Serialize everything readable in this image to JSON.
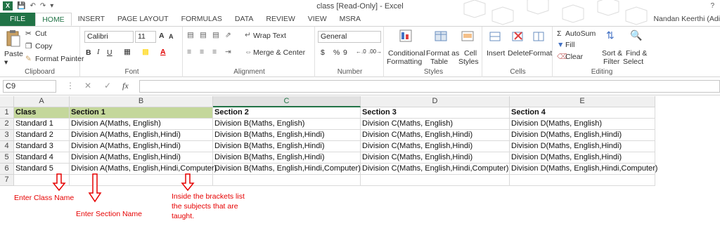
{
  "window": {
    "title": "class  [Read-Only] - Excel",
    "help": "?",
    "user": "Nandan Keerthi (Adi"
  },
  "tabs": [
    "FILE",
    "HOME",
    "INSERT",
    "PAGE LAYOUT",
    "FORMULAS",
    "DATA",
    "REVIEW",
    "VIEW",
    "MSRA"
  ],
  "active_tab": "HOME",
  "ribbon": {
    "clipboard": {
      "paste": "Paste",
      "cut": "Cut",
      "copy": "Copy",
      "format_painter": "Format Painter",
      "label": "Clipboard"
    },
    "font": {
      "name": "Calibri",
      "size": "11",
      "label": "Font",
      "bold": "B",
      "italic": "I",
      "underline": "U",
      "grow": "A",
      "shrink": "A"
    },
    "alignment": {
      "wrap": "Wrap Text",
      "merge": "Merge & Center",
      "label": "Alignment"
    },
    "number": {
      "format": "General",
      "currency": "$",
      "percent": "%",
      "comma": "9",
      "label": "Number"
    },
    "styles": {
      "conditional": "Conditional",
      "conditional2": "Formatting",
      "format_table": "Format as",
      "format_table2": "Table",
      "cell_styles": "Cell",
      "cell_styles2": "Styles",
      "label": "Styles"
    },
    "cells": {
      "insert": "Insert",
      "delete": "Delete",
      "format": "Format",
      "label": "Cells"
    },
    "editing": {
      "autosum": "AutoSum",
      "fill": "Fill",
      "clear": "Clear",
      "sort": "Sort &",
      "sort2": "Filter",
      "find": "Find &",
      "find2": "Select",
      "label": "Editing"
    }
  },
  "formula_bar": {
    "name_box": "C9",
    "fx": "fx",
    "value": ""
  },
  "columns": [
    "A",
    "B",
    "C",
    "D",
    "E"
  ],
  "selected_column": "C",
  "rows": [
    "1",
    "2",
    "3",
    "4",
    "5",
    "6",
    "7"
  ],
  "sheet": [
    [
      "Class",
      "Section 1",
      "Section 2",
      "Section 3",
      "Section 4"
    ],
    [
      "Standard 1",
      "Division A(Maths, English)",
      "Division B(Maths, English)",
      "Division C(Maths, English)",
      "Division D(Maths, English)"
    ],
    [
      "Standard 2",
      "Division A(Maths, English,Hindi)",
      "Division B(Maths, English,Hindi)",
      "Division C(Maths, English,Hindi)",
      "Division D(Maths, English,Hindi)"
    ],
    [
      "Standard 3",
      "Division A(Maths, English,Hindi)",
      "Division B(Maths, English,Hindi)",
      "Division C(Maths, English,Hindi)",
      "Division D(Maths, English,Hindi)"
    ],
    [
      "Standard 4",
      "Division A(Maths, English,Hindi)",
      "Division B(Maths, English,Hindi)",
      "Division C(Maths, English,Hindi)",
      "Division D(Maths, English,Hindi)"
    ],
    [
      "Standard 5",
      "Division A(Maths, English,Hindi,Computer)",
      "Division B(Maths, English,Hindi,Computer)",
      "Division C(Maths, English,Hindi,Computer)",
      "Division D(Maths, English,Hindi,Computer)"
    ],
    [
      "",
      "",
      "",
      "",
      ""
    ]
  ],
  "annotations": {
    "class_note": "Enter Class Name",
    "section_note": "Enter Section Name",
    "subjects_note_1": "Inside the brackets list",
    "subjects_note_2": "the subjects that are",
    "subjects_note_3": "taught."
  },
  "colors": {
    "excel_green": "#217346",
    "header_fill": "#c4d79b",
    "annotation_red": "#e60000"
  }
}
